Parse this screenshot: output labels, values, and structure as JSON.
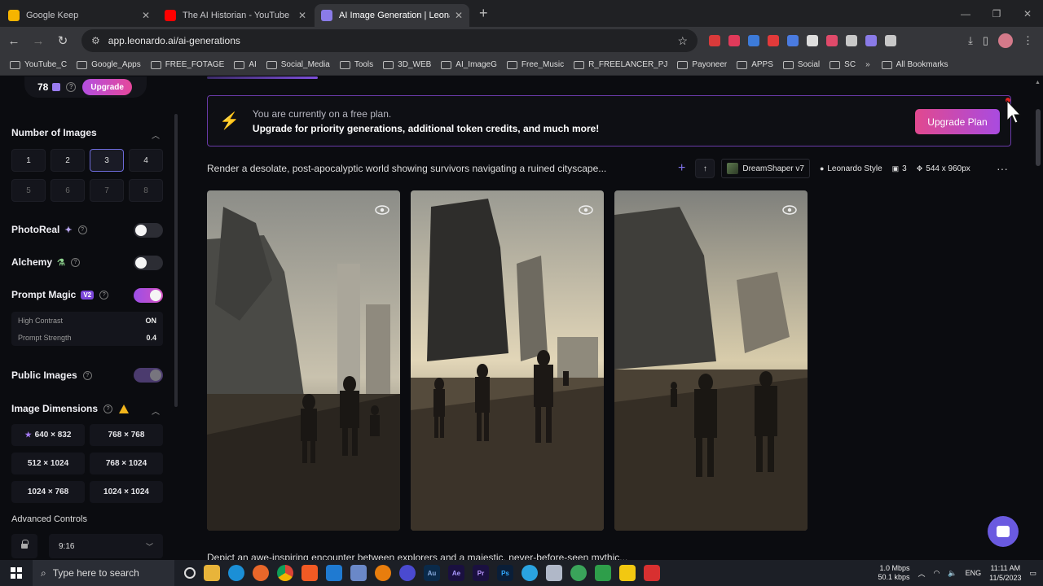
{
  "browser": {
    "tabs": [
      {
        "label": "Google Keep",
        "favicon_color": "#f6b400"
      },
      {
        "label": "The AI Historian - YouTube",
        "favicon_color": "#ff0000"
      },
      {
        "label": "AI Image Generation | Leonardo",
        "favicon_color": "#8a7be8"
      }
    ],
    "url": "app.leonardo.ai/ai-generations",
    "bookmarks": [
      "YouTube_C",
      "Google_Apps",
      "FREE_FOTAGE",
      "AI",
      "Social_Media",
      "Tools",
      "3D_WEB",
      "AI_ImageG",
      "Free_Music",
      "R_FREELANCER_PJ",
      "Payoneer",
      "APPS",
      "Social",
      "SC"
    ],
    "all_bookmarks": "All Bookmarks",
    "extension_colors": [
      "#d93a3a",
      "#e03a5a",
      "#3d7bd9",
      "#e23a3a",
      "#4a7be0",
      "#dddddd",
      "#e04a6a",
      "#c8c8c8",
      "#8a7be8",
      "#c8c8c8"
    ]
  },
  "sidebar": {
    "tokens": "78",
    "upgrade": "Upgrade",
    "number_of_images": {
      "title": "Number of Images",
      "options": [
        "1",
        "2",
        "3",
        "4",
        "5",
        "6",
        "7",
        "8"
      ],
      "selected": "3"
    },
    "photoreal": {
      "label": "PhotoReal",
      "on": false
    },
    "alchemy": {
      "label": "Alchemy",
      "on": false
    },
    "prompt_magic": {
      "label": "Prompt Magic",
      "badge": "V2",
      "on": true,
      "high_contrast_label": "High Contrast",
      "high_contrast_value": "ON",
      "strength_label": "Prompt Strength",
      "strength_value": "0.4"
    },
    "public_images": {
      "label": "Public Images",
      "on": true
    },
    "image_dimensions": {
      "title": "Image Dimensions",
      "options": [
        "640 × 832",
        "768 × 768",
        "512 × 1024",
        "768 × 1024",
        "1024 × 768",
        "1024 × 1024"
      ]
    },
    "advanced_controls": "Advanced Controls",
    "aspect_ratio": "9:16"
  },
  "main": {
    "banner": {
      "line1": "You are currently on a free plan.",
      "line2": "Upgrade for priority generations, additional token credits, and much more!",
      "button": "Upgrade Plan"
    },
    "generation": {
      "prompt": "Render a desolate, post-apocalyptic world showing survivors navigating a ruined cityscape...",
      "model": "DreamShaper v7",
      "style": "Leonardo Style",
      "count": "3",
      "size": "544 x 960px"
    },
    "next_prompt": "Depict an awe-inspiring encounter between explorers and a majestic, never-before-seen mythic..."
  },
  "taskbar": {
    "search_placeholder": "Type here to search",
    "net_up": "1.0 Mbps",
    "net_down": "50.1 kbps",
    "lang": "ENG",
    "time": "11:11 AM",
    "date": "11/5/2023"
  }
}
